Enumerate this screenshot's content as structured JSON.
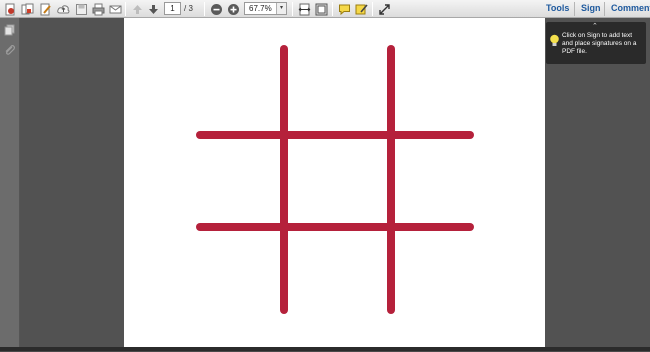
{
  "toolbar": {
    "page_current": "1",
    "page_separator_total": "/ 3",
    "zoom_value": "67.7%",
    "zoom_arrow": "▾",
    "links": {
      "tools": "Tools",
      "sign": "Sign",
      "comment": "Comment"
    },
    "icons": [
      "create-pdf-icon",
      "combine-files-icon",
      "edit-icon",
      "cloud-upload-icon",
      "save-icon",
      "print-icon",
      "email-icon",
      "previous-page-icon",
      "next-page-icon",
      "zoom-out-icon",
      "zoom-in-icon",
      "fit-width-icon",
      "fit-page-icon",
      "comment-icon",
      "highlight-icon",
      "fullscreen-icon"
    ]
  },
  "left_panel": {
    "icons": [
      "page-thumbnails-icon",
      "attachments-icon"
    ]
  },
  "tooltip": {
    "text": "Click on Sign to add text and place signatures on a PDF file.",
    "caret": "⌃",
    "icon": "lightbulb-icon"
  },
  "document": {
    "content": "tic-tac-toe grid",
    "line_color": "#b5213b"
  }
}
